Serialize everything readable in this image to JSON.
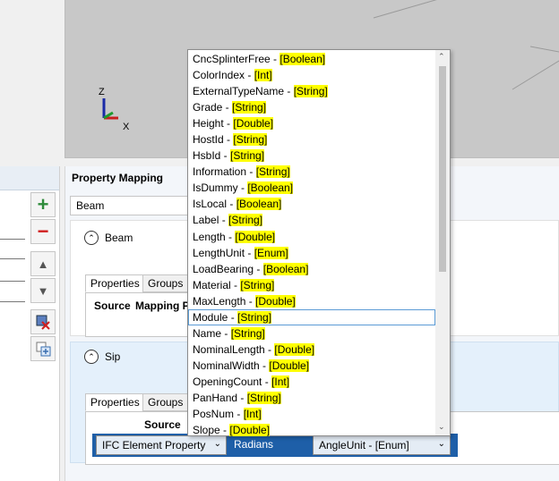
{
  "viewport": {
    "axis_z": "Z",
    "axis_x": "X"
  },
  "toolbar": {
    "add": "+",
    "remove": "−",
    "up": "▲",
    "down": "▼"
  },
  "property_mapping": {
    "title": "Property Mapping",
    "selector_value": "Beam",
    "beam": {
      "label": "Beam",
      "tabs": [
        "Properties",
        "Groups"
      ],
      "columns": [
        "Source",
        "Mapping P"
      ]
    },
    "sip": {
      "label": "Sip",
      "tabs": [
        "Properties",
        "Groups"
      ],
      "columns": [
        "Source"
      ],
      "row": {
        "source": "IFC Element Property",
        "value": "Radians",
        "target": "AngleUnit - [Enum]"
      }
    }
  },
  "dropdown": {
    "items": [
      {
        "name": "CncSplinterFree - ",
        "type": "[Boolean]"
      },
      {
        "name": "ColorIndex - ",
        "type": "[Int]"
      },
      {
        "name": "ExternalTypeName - ",
        "type": "[String]"
      },
      {
        "name": "Grade - ",
        "type": "[String]"
      },
      {
        "name": "Height - ",
        "type": "[Double]"
      },
      {
        "name": "HostId - ",
        "type": "[String]"
      },
      {
        "name": "HsbId - ",
        "type": "[String]"
      },
      {
        "name": "Information - ",
        "type": "[String]"
      },
      {
        "name": "IsDummy - ",
        "type": "[Boolean]"
      },
      {
        "name": "IsLocal - ",
        "type": "[Boolean]"
      },
      {
        "name": "Label - ",
        "type": "[String]"
      },
      {
        "name": "Length - ",
        "type": "[Double]"
      },
      {
        "name": "LengthUnit - ",
        "type": "[Enum]"
      },
      {
        "name": "LoadBearing - ",
        "type": "[Boolean]"
      },
      {
        "name": "Material - ",
        "type": "[String]"
      },
      {
        "name": "MaxLength - ",
        "type": "[Double]"
      },
      {
        "name": "Module - ",
        "type": "[String]"
      },
      {
        "name": "Name - ",
        "type": "[String]"
      },
      {
        "name": "NominalLength - ",
        "type": "[Double]"
      },
      {
        "name": "NominalWidth - ",
        "type": "[Double]"
      },
      {
        "name": "OpeningCount - ",
        "type": "[Int]"
      },
      {
        "name": "PanHand - ",
        "type": "[String]"
      },
      {
        "name": "PosNum - ",
        "type": "[Int]"
      },
      {
        "name": "Slope - ",
        "type": "[Double]"
      }
    ],
    "focused_index": 16
  },
  "colors": {
    "highlight": "#ffff00",
    "focus": "#5b9bd5",
    "cell_selected": "#1e5fa8"
  }
}
